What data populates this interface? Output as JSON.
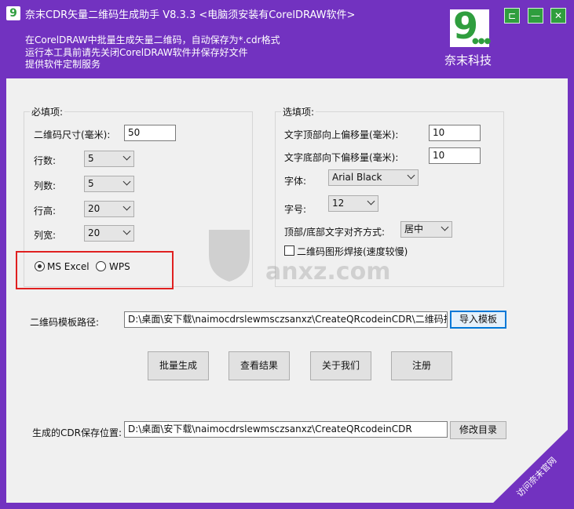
{
  "window": {
    "title": "奈末CDR矢量二维码生成助手 V8.3.3   <电脑须安装有CorelDRAW软件>",
    "description_lines": [
      "在CorelDRAW中批量生成矢量二维码，自动保存为*.cdr格式",
      "运行本工具前请先关闭CorelDRAW软件并保存好文件",
      "提供软件定制服务"
    ],
    "brand_name": "奈末科技",
    "controls": {
      "pin": "⊏",
      "minimize": "—",
      "close": "✕"
    }
  },
  "required": {
    "group_title": "必填项:",
    "qr_size_label": "二维码尺寸(毫米):",
    "qr_size_value": "50",
    "rows_label": "行数:",
    "rows_value": "5",
    "cols_label": "列数:",
    "cols_value": "5",
    "row_height_label": "行高:",
    "row_height_value": "20",
    "col_width_label": "列宽:",
    "col_width_value": "20",
    "source_options": [
      "MS Excel",
      "WPS"
    ],
    "source_selected": "MS Excel"
  },
  "optional": {
    "group_title": "选填项:",
    "top_offset_label": "文字顶部向上偏移量(毫米):",
    "top_offset_value": "10",
    "bottom_offset_label": "文字底部向下偏移量(毫米):",
    "bottom_offset_value": "10",
    "font_label": "字体:",
    "font_value": "Arial Black",
    "size_label": "字号:",
    "size_value": "12",
    "align_label": "顶部/底部文字对齐方式:",
    "align_value": "居中",
    "stitch_label": "二维码图形焊接(速度较慢)",
    "stitch_checked": false
  },
  "template": {
    "label": "二维码模板路径:",
    "path": "D:\\桌面\\安下载\\naimocdrslewmsczsanxz\\CreateQRcodeinCDR\\二维码批量生",
    "import_button": "导入模板"
  },
  "actions": {
    "batch": "批量生成",
    "view": "查看结果",
    "about": "关于我们",
    "register": "注册"
  },
  "output": {
    "label": "生成的CDR保存位置:",
    "path": "D:\\桌面\\安下载\\naimocdrslewmsczsanxz\\CreateQRcodeinCDR",
    "change_button": "修改目录"
  },
  "corner_link": "访问奈末官网",
  "watermark_text": "anxz.com",
  "colors": {
    "header": "#7232c0",
    "brand_green": "#2f9e3e",
    "highlight": "#e02020",
    "focus": "#0078d7"
  }
}
